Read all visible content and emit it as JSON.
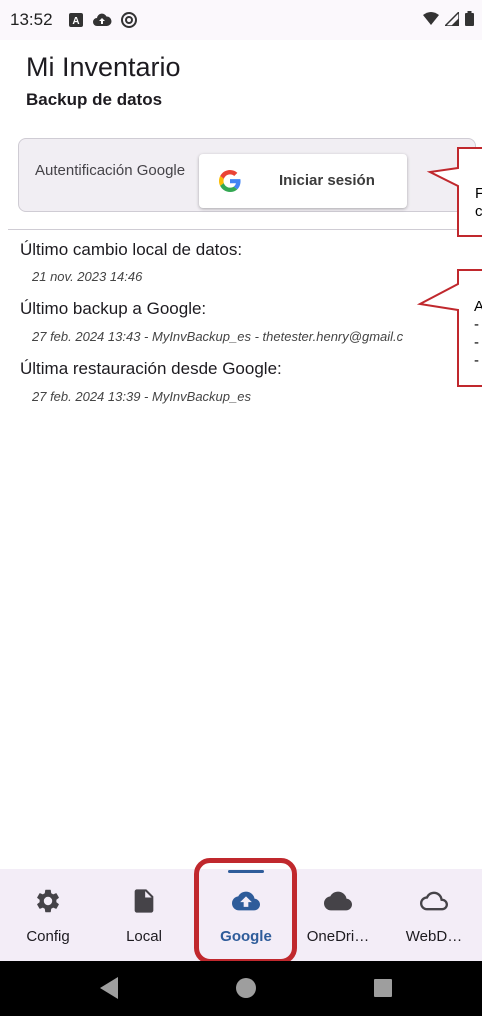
{
  "status_bar": {
    "time": "13:52"
  },
  "header": {
    "title": "Mi Inventario",
    "subtitle": "Backup de datos"
  },
  "auth": {
    "label": "Autentificación Google",
    "button_label": "Iniciar sesión",
    "icon": "google-g-icon"
  },
  "info": {
    "last_local_change_label": "Último cambio local de datos:",
    "last_local_change_value": "21 nov. 2023 14:46",
    "last_backup_label": "Último backup a Google:",
    "last_backup_value": "27 feb. 2024 13:43 - MyInvBackup_es - thetester.henry@gmail.c",
    "last_restore_label": "Última restauración desde Google:",
    "last_restore_value": "27 feb. 2024 13:39 - MyInvBackup_es"
  },
  "callouts": {
    "first_text": "F\nc",
    "second_text": "A\n-\n-\n-"
  },
  "bottom_nav": {
    "items": [
      {
        "label": "Config",
        "icon": "gear-icon"
      },
      {
        "label": "Local",
        "icon": "file-icon"
      },
      {
        "label": "Google",
        "icon": "cloud-upload-icon",
        "active": true
      },
      {
        "label": "OneDri…",
        "icon": "cloud-filled-icon"
      },
      {
        "label": "WebD…",
        "icon": "cloud-outline-icon"
      }
    ]
  },
  "colors": {
    "accent": "#2e5c9a",
    "highlight": "#c0282d",
    "callout_border": "#c0282d",
    "nav_background": "#f3edf7"
  }
}
